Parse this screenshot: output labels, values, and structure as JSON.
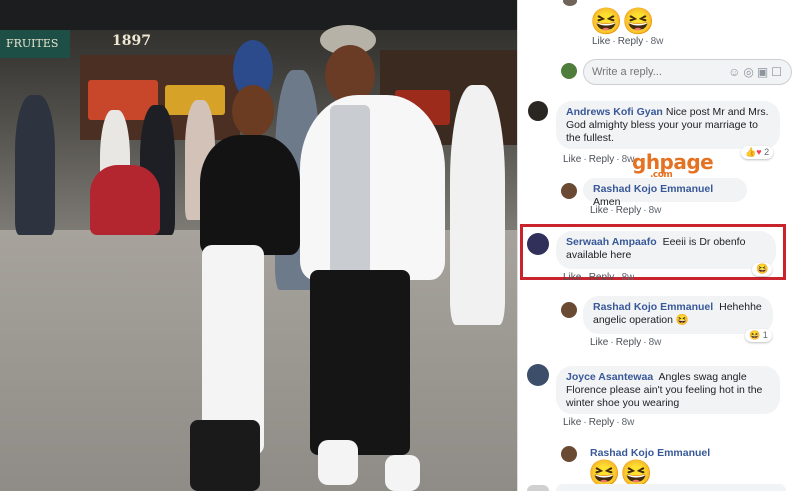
{
  "photo": {
    "store_sign": "FRUITES",
    "year_sign": "1897"
  },
  "watermark": {
    "brand": "ghpage",
    "domain": ".com"
  },
  "comments": [
    {
      "emoji": "😆😆",
      "like": "Like",
      "reply": "Reply",
      "time": "8w"
    },
    {
      "reply_placeholder": "Write a reply..."
    },
    {
      "name": "Andrews Kofi Gyan",
      "text": "Nice post Mr and Mrs. God almighty bless your your marriage to the fullest.",
      "like": "Like",
      "reply": "Reply",
      "time": "8w",
      "reactions": "2"
    },
    {
      "name": "Rashad Kojo Emmanuel",
      "text": "Amen",
      "like": "Like",
      "reply": "Reply",
      "time": "8w"
    },
    {
      "name": "Serwaah Ampaafo",
      "text": "Eeeii is Dr obenfo available here",
      "like": "Like",
      "reply": "Reply",
      "time": "8w",
      "reactions": "😆"
    },
    {
      "name": "Rashad Kojo Emmanuel",
      "text": "Hehehhe angelic operation 😆",
      "like": "Like",
      "reply": "Reply",
      "time": "8w",
      "reactions": "1"
    },
    {
      "name": "Joyce Asantewaa",
      "text": "Angles swag angle Florence please ain't you feeling hot in the winter shoe you wearing",
      "like": "Like",
      "reply": "Reply",
      "time": "8w"
    },
    {
      "name": "Rashad Kojo Emmanuel",
      "emoji": "😆😆"
    }
  ],
  "colors": {
    "fb_link": "#385898",
    "highlight": "#c9232e",
    "watermark": "#e57222"
  }
}
